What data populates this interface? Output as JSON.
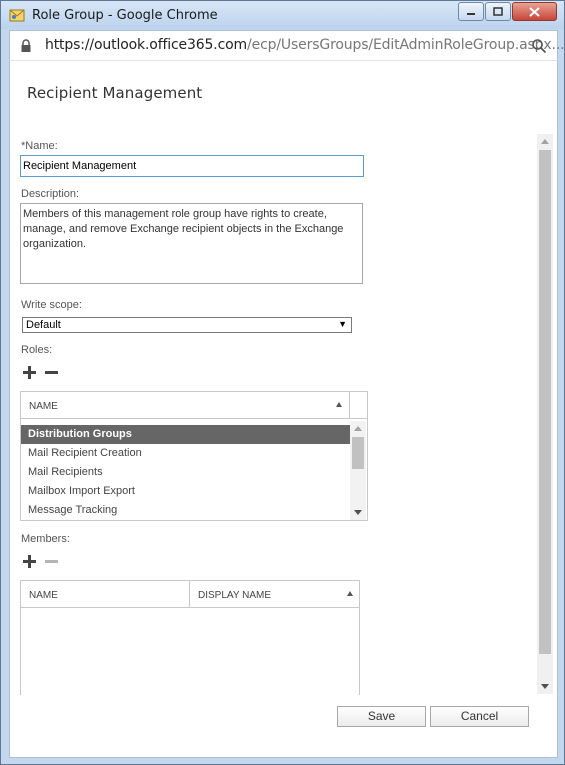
{
  "window": {
    "title": "Role Group - Google Chrome",
    "url_host": "https://outlook.office365.com",
    "url_path": "/ecp/UsersGroups/EditAdminRoleGroup.aspx..."
  },
  "page": {
    "title": "Recipient Management"
  },
  "form": {
    "name_label": "*Name:",
    "name_value": "Recipient Management",
    "description_label": "Description:",
    "description_value": "Members of this management role group have rights to create, manage, and remove Exchange recipient objects in the Exchange organization.",
    "write_scope_label": "Write scope:",
    "write_scope_value": "Default",
    "roles_label": "Roles:",
    "members_label": "Members:"
  },
  "roles_grid": {
    "column_name": "NAME",
    "rows": [
      {
        "name": "Distribution Groups",
        "selected": true
      },
      {
        "name": "Mail Recipient Creation",
        "selected": false
      },
      {
        "name": "Mail Recipients",
        "selected": false
      },
      {
        "name": "Mailbox Import Export",
        "selected": false
      },
      {
        "name": "Message Tracking",
        "selected": false
      }
    ]
  },
  "members_grid": {
    "column_name": "NAME",
    "column_display_name": "DISPLAY NAME",
    "rows": []
  },
  "footer": {
    "save_label": "Save",
    "cancel_label": "Cancel"
  },
  "icons": {
    "window": "role-group-app-icon",
    "lock": "lock-icon",
    "zoom": "magnifier-icon",
    "add": "plus-icon",
    "remove": "minus-icon",
    "sort": "sort-ascending-icon",
    "dropdown": "chevron-down-icon"
  },
  "colors": {
    "selected_row_bg": "#666666",
    "focus_border": "#5a9bd5",
    "titlebar": "#c3d7ee",
    "close_button": "#c7453a"
  }
}
